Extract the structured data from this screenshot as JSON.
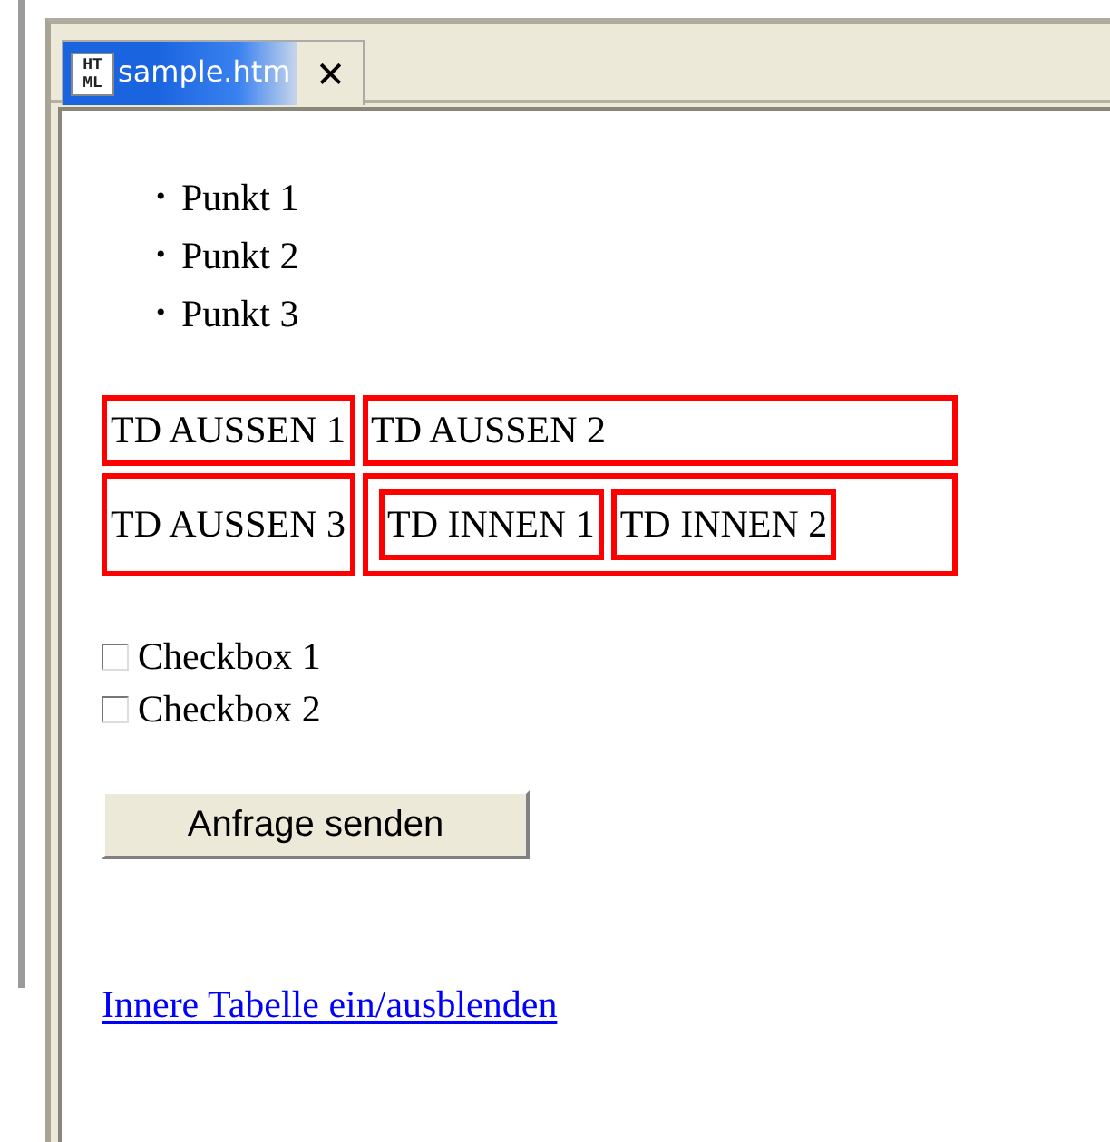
{
  "tab": {
    "icon_lines": [
      "HT",
      "ML"
    ],
    "title": "sample.htm",
    "selected": true,
    "close": "✕"
  },
  "list": [
    {
      "marker": "•",
      "text": "Punkt 1"
    },
    {
      "marker": "•",
      "text": "Punkt 2"
    },
    {
      "marker": "•",
      "text": "Punkt 3"
    }
  ],
  "table": {
    "rows": [
      {
        "cells": [
          "TD AUSSEN 1",
          "TD AUSSEN 2"
        ]
      },
      {
        "cells": [
          "TD AUSSEN 3"
        ],
        "inner_cells": [
          "TD INNEN 1",
          "TD INNEN 2"
        ]
      }
    ]
  },
  "checkboxes": [
    {
      "label": "Checkbox 1",
      "checked": false
    },
    {
      "label": "Checkbox 2",
      "checked": false
    }
  ],
  "button": "Anfrage senden",
  "link": "Innere Tabelle ein/ausblenden"
}
